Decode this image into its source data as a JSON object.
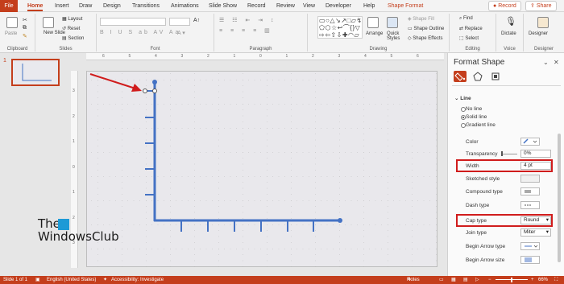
{
  "tabs": [
    "File",
    "Home",
    "Insert",
    "Draw",
    "Design",
    "Transitions",
    "Animations",
    "Slide Show",
    "Record",
    "Review",
    "View",
    "Developer",
    "Help",
    "Shape Format"
  ],
  "title_buttons": {
    "record": "Record",
    "share": "Share"
  },
  "ribbon": {
    "clipboard": {
      "paste": "Paste",
      "label": "Clipboard"
    },
    "slides": {
      "new_slide": "New Slide",
      "layout": "Layout",
      "reset": "Reset",
      "section": "Section",
      "label": "Slides"
    },
    "font": {
      "label": "Font"
    },
    "paragraph": {
      "label": "Paragraph"
    },
    "drawing": {
      "arrange": "Arrange",
      "quick_styles": "Quick Styles",
      "shape_fill": "Shape Fill",
      "shape_outline": "Shape Outline",
      "shape_effects": "Shape Effects",
      "label": "Drawing"
    },
    "editing": {
      "find": "Find",
      "replace": "Replace",
      "select": "Select",
      "label": "Editing"
    },
    "voice": {
      "dictate": "Dictate",
      "label": "Voice"
    },
    "designer": {
      "designer": "Designer",
      "label": "Designer"
    }
  },
  "slide_panel": {
    "slide_number": "1"
  },
  "ruler_h": [
    "6",
    "5",
    "4",
    "3",
    "2",
    "1",
    "0",
    "1",
    "2",
    "3",
    "4",
    "5",
    "6"
  ],
  "ruler_v": [
    "3",
    "2",
    "1",
    "0",
    "1",
    "2",
    "3"
  ],
  "watermark": {
    "line1": "The",
    "line2": "WindowsClub"
  },
  "format_pane": {
    "title": "Format Shape",
    "section": "Line",
    "options": [
      "No line",
      "Solid line",
      "Gradient line"
    ],
    "selected_option": "Solid line",
    "rows": {
      "color": "Color",
      "transparency": "Transparency",
      "width": "Width",
      "sketched": "Sketched style",
      "compound": "Compound type",
      "dash": "Dash type",
      "cap": "Cap type",
      "join": "Join type",
      "begin_arrow_type": "Begin Arrow type",
      "begin_arrow_size": "Begin Arrow size"
    },
    "values": {
      "transparency": "0%",
      "width": "4 pt",
      "cap": "Round",
      "join": "Miter"
    }
  },
  "status": {
    "slide": "Slide 1 of 1",
    "language": "English (United States)",
    "accessibility": "Accessibility: Investigate",
    "notes": "Notes",
    "zoom": "66%"
  },
  "colors": {
    "accent": "#c43e1c",
    "line": "#4472c4",
    "highlight": "#d01c1c"
  }
}
